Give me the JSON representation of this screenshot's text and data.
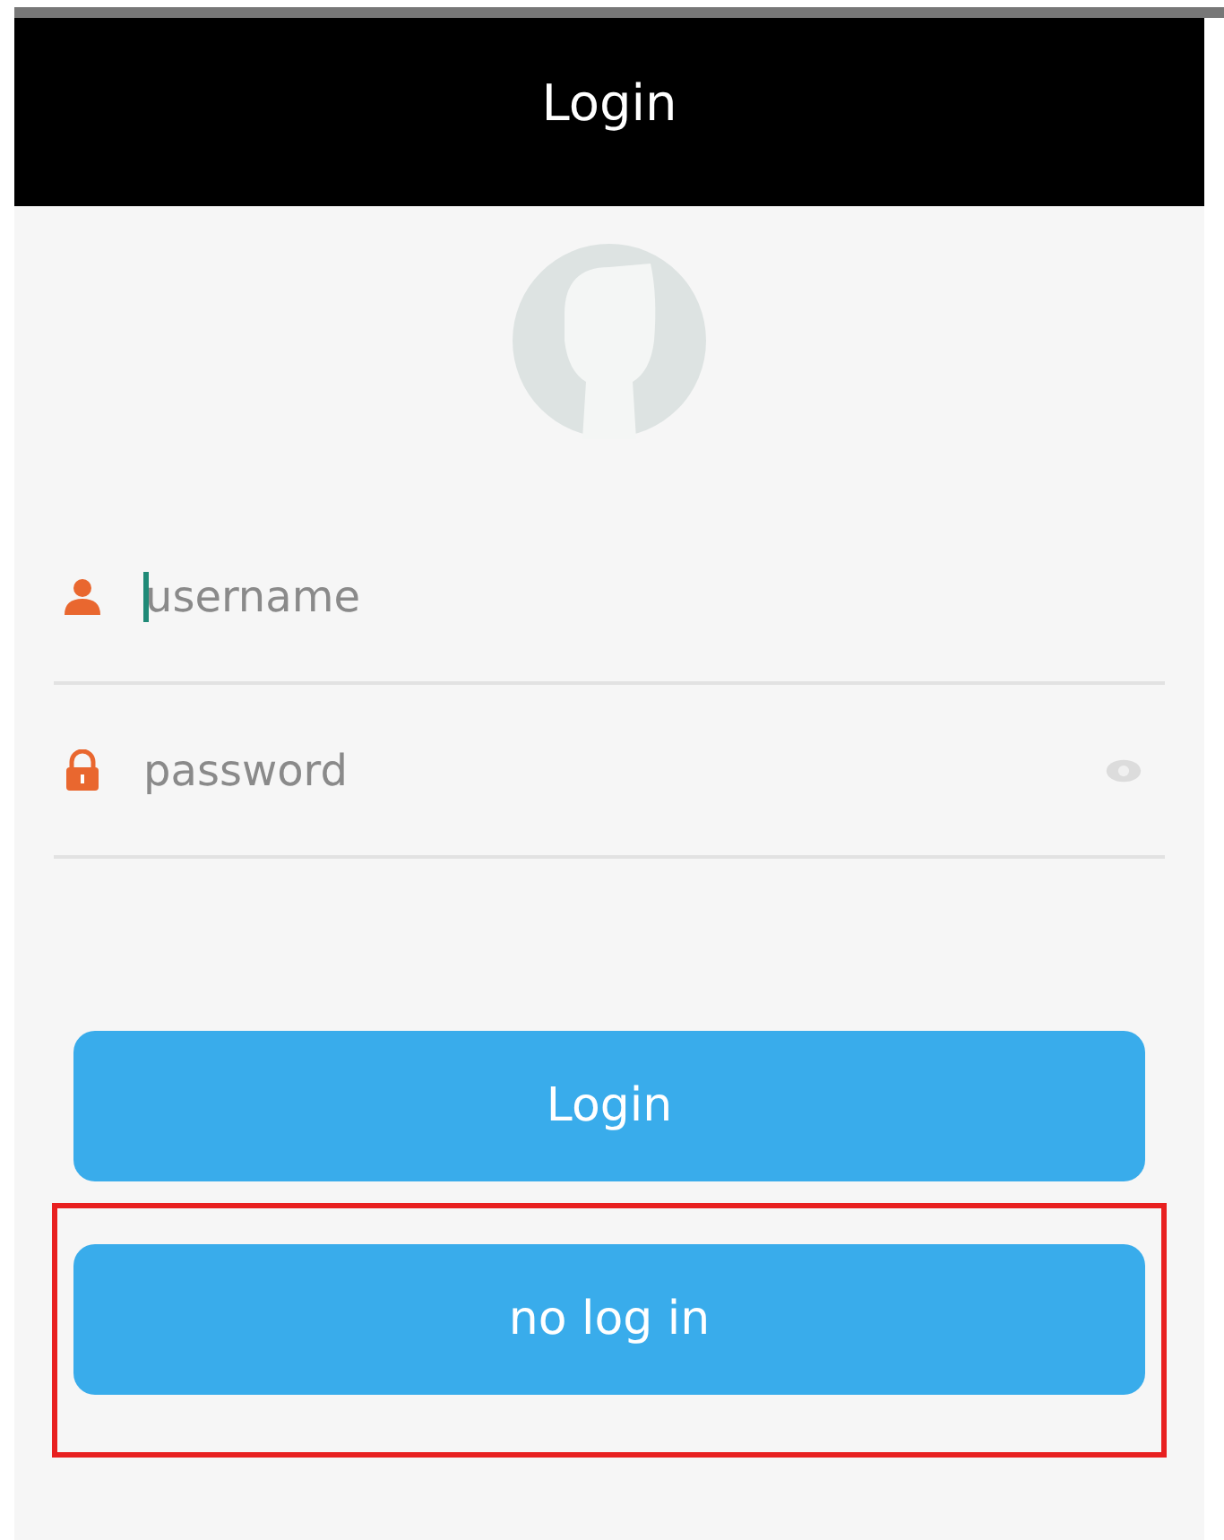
{
  "app_bar": {
    "title": "Login"
  },
  "fields": [
    {
      "kind": "username",
      "placeholder": "username",
      "focused": true
    },
    {
      "kind": "password",
      "placeholder": "password",
      "focused": false
    }
  ],
  "buttons": [
    {
      "label": "Login",
      "highlighted": false
    },
    {
      "label": "no log in",
      "highlighted": true
    }
  ]
}
